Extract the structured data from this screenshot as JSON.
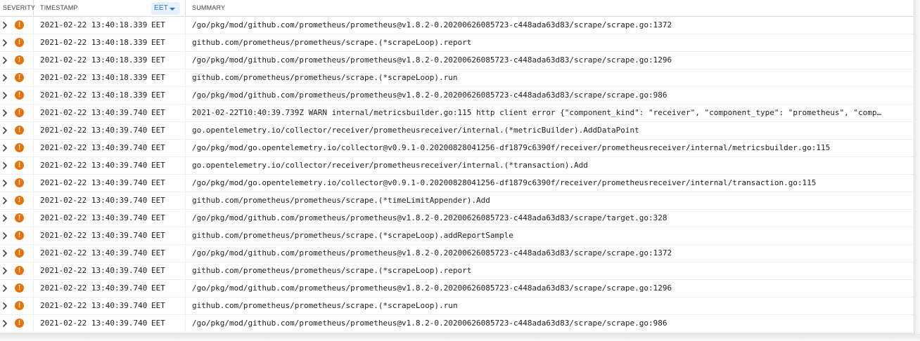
{
  "header": {
    "severity": "SEVERITY",
    "timestamp": "TIMESTAMP",
    "timezone": "EET",
    "summary": "SUMMARY"
  },
  "rows": [
    {
      "date": "2021-02-22 13:40:18.339",
      "tz": "EET",
      "summary": "/go/pkg/mod/github.com/prometheus/prometheus@v1.8.2-0.20200626085723-c448ada63d83/scrape/scrape.go:1372"
    },
    {
      "date": "2021-02-22 13:40:18.339",
      "tz": "EET",
      "summary": "github.com/prometheus/prometheus/scrape.(*scrapeLoop).report"
    },
    {
      "date": "2021-02-22 13:40:18.339",
      "tz": "EET",
      "summary": "/go/pkg/mod/github.com/prometheus/prometheus@v1.8.2-0.20200626085723-c448ada63d83/scrape/scrape.go:1296"
    },
    {
      "date": "2021-02-22 13:40:18.339",
      "tz": "EET",
      "summary": "github.com/prometheus/prometheus/scrape.(*scrapeLoop).run"
    },
    {
      "date": "2021-02-22 13:40:18.339",
      "tz": "EET",
      "summary": "/go/pkg/mod/github.com/prometheus/prometheus@v1.8.2-0.20200626085723-c448ada63d83/scrape/scrape.go:986"
    },
    {
      "date": "2021-02-22 13:40:39.740",
      "tz": "EET",
      "summary": "2021-02-22T10:40:39.739Z WARN internal/metricsbuilder.go:115 http client error {\"component_kind\": \"receiver\", \"component_type\": \"prometheus\", \"comp…"
    },
    {
      "date": "2021-02-22 13:40:39.740",
      "tz": "EET",
      "summary": "go.opentelemetry.io/collector/receiver/prometheusreceiver/internal.(*metricBuilder).AddDataPoint"
    },
    {
      "date": "2021-02-22 13:40:39.740",
      "tz": "EET",
      "summary": "/go/pkg/mod/go.opentelemetry.io/collector@v0.9.1-0.20200828041256-df1879c6390f/receiver/prometheusreceiver/internal/metricsbuilder.go:115"
    },
    {
      "date": "2021-02-22 13:40:39.740",
      "tz": "EET",
      "summary": "go.opentelemetry.io/collector/receiver/prometheusreceiver/internal.(*transaction).Add"
    },
    {
      "date": "2021-02-22 13:40:39.740",
      "tz": "EET",
      "summary": "/go/pkg/mod/go.opentelemetry.io/collector@v0.9.1-0.20200828041256-df1879c6390f/receiver/prometheusreceiver/internal/transaction.go:115"
    },
    {
      "date": "2021-02-22 13:40:39.740",
      "tz": "EET",
      "summary": "github.com/prometheus/prometheus/scrape.(*timeLimitAppender).Add"
    },
    {
      "date": "2021-02-22 13:40:39.740",
      "tz": "EET",
      "summary": "/go/pkg/mod/github.com/prometheus/prometheus@v1.8.2-0.20200626085723-c448ada63d83/scrape/target.go:328"
    },
    {
      "date": "2021-02-22 13:40:39.740",
      "tz": "EET",
      "summary": "github.com/prometheus/prometheus/scrape.(*scrapeLoop).addReportSample"
    },
    {
      "date": "2021-02-22 13:40:39.740",
      "tz": "EET",
      "summary": "/go/pkg/mod/github.com/prometheus/prometheus@v1.8.2-0.20200626085723-c448ada63d83/scrape/scrape.go:1372"
    },
    {
      "date": "2021-02-22 13:40:39.740",
      "tz": "EET",
      "summary": "github.com/prometheus/prometheus/scrape.(*scrapeLoop).report"
    },
    {
      "date": "2021-02-22 13:40:39.740",
      "tz": "EET",
      "summary": "/go/pkg/mod/github.com/prometheus/prometheus@v1.8.2-0.20200626085723-c448ada63d83/scrape/scrape.go:1296"
    },
    {
      "date": "2021-02-22 13:40:39.740",
      "tz": "EET",
      "summary": "github.com/prometheus/prometheus/scrape.(*scrapeLoop).run"
    },
    {
      "date": "2021-02-22 13:40:39.740",
      "tz": "EET",
      "summary": "/go/pkg/mod/github.com/prometheus/prometheus@v1.8.2-0.20200626085723-c448ada63d83/scrape/scrape.go:986"
    }
  ],
  "icons": {
    "expand": "chevron-right-icon",
    "severity": "warning-icon",
    "timezone_dropdown": "caret-down-icon"
  },
  "colors": {
    "warning": "#e8710a",
    "accent": "#1a73e8",
    "accent_bg": "#e8f0fe"
  }
}
